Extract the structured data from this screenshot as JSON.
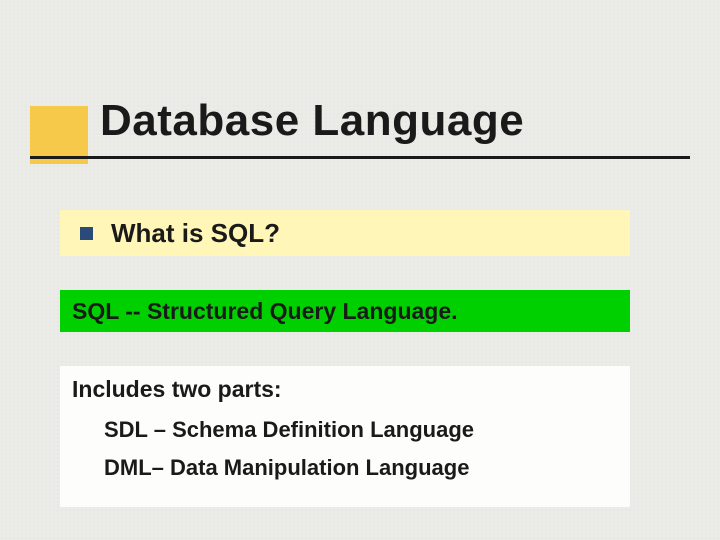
{
  "title": "Database Language",
  "question": "What is SQL?",
  "answer": "SQL -- Structured Query Language.",
  "parts_intro": "Includes two parts:",
  "parts": [
    "SDL – Schema Definition Language",
    "DML– Data Manipulation Language"
  ]
}
